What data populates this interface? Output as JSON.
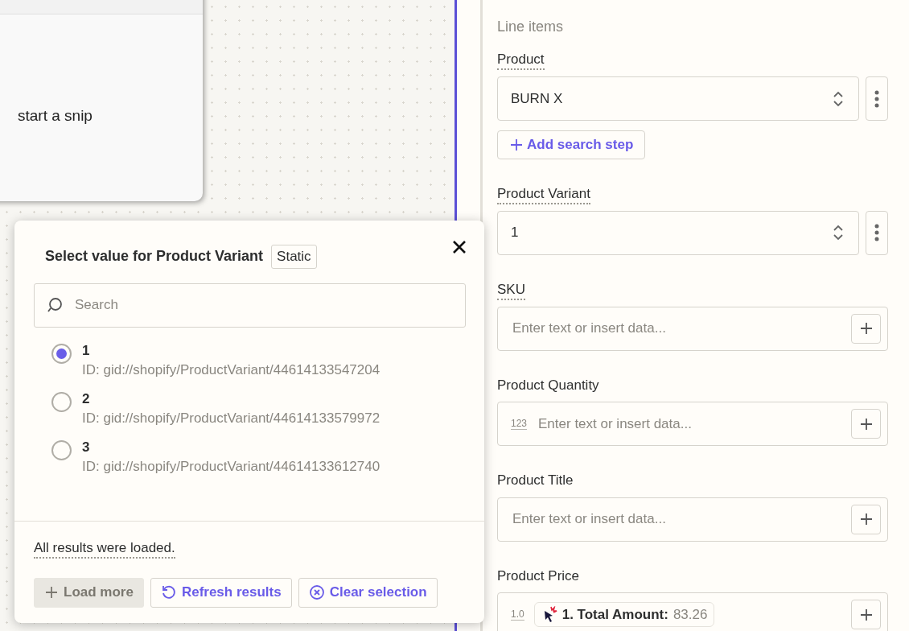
{
  "canvas": {
    "card_text": "start a snip"
  },
  "panel": {
    "section_title": "Line items",
    "fields": [
      {
        "label": "Product",
        "underlined": true,
        "kind": "select",
        "value": "BURN X",
        "add_step": "Add search step"
      },
      {
        "label": "Product Variant",
        "underlined": true,
        "kind": "select",
        "value": "1"
      },
      {
        "label": "SKU",
        "underlined": true,
        "kind": "text",
        "placeholder": "Enter text or insert data..."
      },
      {
        "label": "Product Quantity",
        "underlined": false,
        "kind": "text",
        "type_badge": "123",
        "placeholder": "Enter text or insert data..."
      },
      {
        "label": "Product Title",
        "underlined": false,
        "kind": "text",
        "placeholder": "Enter text or insert data..."
      },
      {
        "label": "Product Price",
        "underlined": false,
        "kind": "text",
        "type_badge": "1.0",
        "token": {
          "label": "1. Total Amount:",
          "value": "83.26"
        }
      }
    ]
  },
  "popup": {
    "title": "Select value for Product Variant",
    "badge": "Static",
    "search": {
      "placeholder": "Search"
    },
    "options": [
      {
        "label": "1",
        "id": "ID: gid://shopify/ProductVariant/44614133547204",
        "selected": true
      },
      {
        "label": "2",
        "id": "ID: gid://shopify/ProductVariant/44614133579972",
        "selected": false
      },
      {
        "label": "3",
        "id": "ID: gid://shopify/ProductVariant/44614133612740",
        "selected": false
      }
    ],
    "status": "All results were loaded.",
    "buttons": [
      {
        "label": "Load more",
        "kind": "add",
        "disabled": true
      },
      {
        "label": "Refresh results",
        "kind": "refresh",
        "disabled": false
      },
      {
        "label": "Clear selection",
        "kind": "clear",
        "disabled": false
      }
    ]
  }
}
